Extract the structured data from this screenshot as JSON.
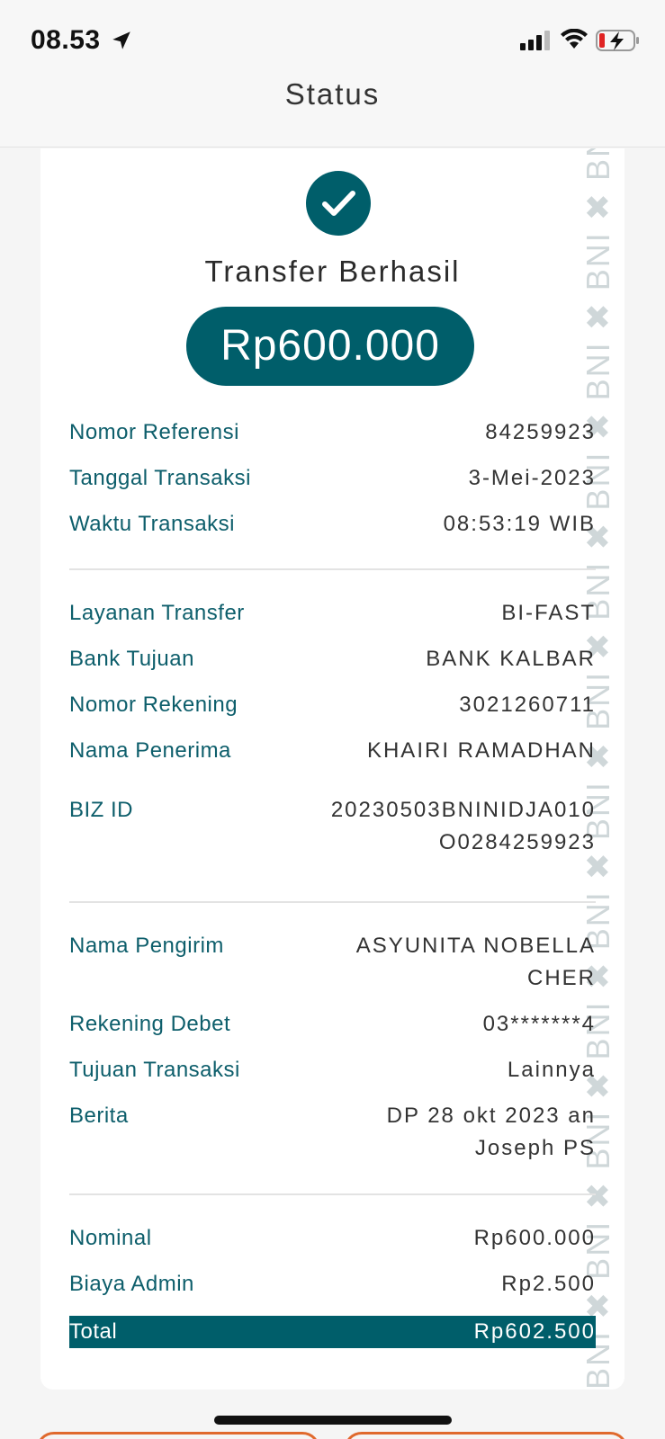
{
  "status_bar": {
    "time": "08.53"
  },
  "header": {
    "title": "Status"
  },
  "receipt": {
    "title": "Transfer Berhasil",
    "amount": "Rp600.000",
    "watermark": "BNI",
    "section1": [
      {
        "label": "Nomor Referensi",
        "value": "84259923"
      },
      {
        "label": "Tanggal Transaksi",
        "value": "3-Mei-2023"
      },
      {
        "label": "Waktu Transaksi",
        "value": "08:53:19 WIB"
      }
    ],
    "section2": [
      {
        "label": "Layanan Transfer",
        "value": "BI-FAST"
      },
      {
        "label": "Bank Tujuan",
        "value": "BANK KALBAR"
      },
      {
        "label": "Nomor Rekening",
        "value": "3021260711"
      },
      {
        "label": "Nama Penerima",
        "value": "KHAIRI RAMADHAN"
      },
      {
        "label": "BIZ ID",
        "value": "20230503BNINIDJA010\nO0284259923"
      }
    ],
    "section3": [
      {
        "label": "Nama Pengirim",
        "value": "ASYUNITA NOBELLA\nCHER"
      },
      {
        "label": "Rekening Debet",
        "value": "03*******4"
      },
      {
        "label": "Tujuan Transaksi",
        "value": "Lainnya"
      },
      {
        "label": "Berita",
        "value": "DP 28 okt 2023 an\nJoseph PS"
      }
    ],
    "section4": [
      {
        "label": "Nominal",
        "value": "Rp600.000"
      },
      {
        "label": "Biaya Admin",
        "value": "Rp2.500"
      }
    ],
    "total": {
      "label": "Total",
      "value": "Rp602.500"
    }
  },
  "colors": {
    "brand": "#005e6a",
    "label": "#0d5e6b",
    "accent_orange": "#e0692d"
  }
}
